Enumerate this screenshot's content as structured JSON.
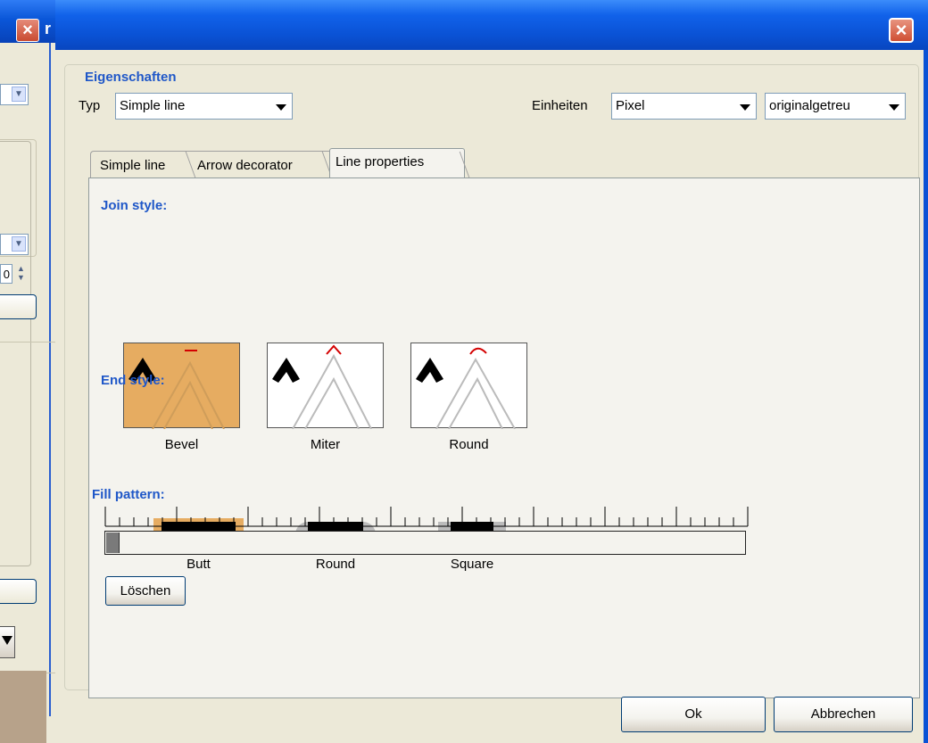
{
  "background_window": {
    "close_glyph": "×",
    "title_fragment": "r",
    "spinner_value": "0"
  },
  "dialog": {
    "close_glyph": "×",
    "group_title": "Eigenschaften",
    "type": {
      "label": "Typ",
      "value": "Simple line"
    },
    "units": {
      "label": "Einheiten",
      "value": "Pixel",
      "scale_value": "originalgetreu"
    },
    "tabs": [
      {
        "label": "Simple line",
        "selected": false
      },
      {
        "label": "Arrow decorator",
        "selected": false
      },
      {
        "label": "Line properties",
        "selected": true
      }
    ],
    "join_style": {
      "title": "Join style:",
      "options": [
        {
          "label": "Bevel",
          "selected": true
        },
        {
          "label": "Miter",
          "selected": false
        },
        {
          "label": "Round",
          "selected": false
        }
      ]
    },
    "end_style": {
      "title": "End style:",
      "options": [
        {
          "label": "Butt",
          "selected": true
        },
        {
          "label": "Round",
          "selected": false
        },
        {
          "label": "Square",
          "selected": false
        }
      ]
    },
    "fill_pattern": {
      "title": "Fill pattern:",
      "clear_label": "Löschen",
      "filled_cells": [
        0
      ],
      "total_cells": 45
    },
    "buttons": {
      "ok": "Ok",
      "cancel": "Abbrechen"
    }
  },
  "colors": {
    "title_blue": "#0a52d5",
    "section_blue": "#1f57c8",
    "selection_orange": "#e6ac61",
    "close_red": "#cf4f33"
  }
}
